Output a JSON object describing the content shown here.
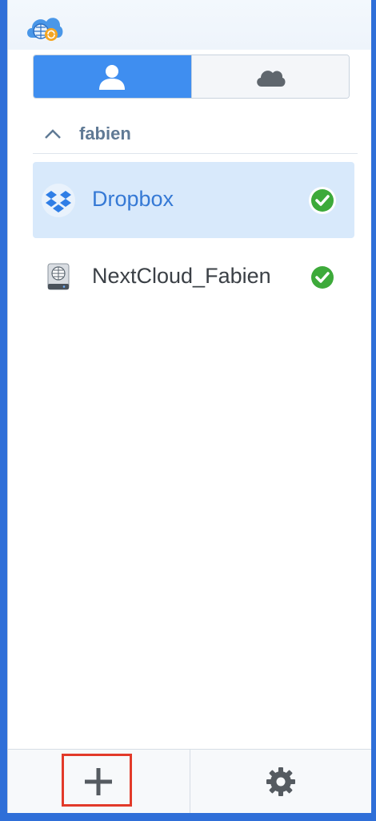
{
  "app": {
    "icon": "cloud-sync-app-icon"
  },
  "tabs": [
    {
      "name": "user-tab",
      "icon": "user-icon",
      "active": true
    },
    {
      "name": "cloud-tab",
      "icon": "cloud-icon",
      "active": false
    }
  ],
  "group": {
    "name": "fabien",
    "icon": "chevron-up-icon"
  },
  "connections": [
    {
      "label": "Dropbox",
      "icon": "dropbox-icon",
      "status": "synced",
      "selected": true
    },
    {
      "label": "NextCloud_Fabien",
      "icon": "webdav-server-icon",
      "status": "synced",
      "selected": false
    }
  ],
  "footer": {
    "add_icon": "plus-icon",
    "settings_icon": "gear-icon"
  },
  "colors": {
    "accent": "#3f8ef0",
    "selected_bg": "#d8e9fb",
    "status_ok": "#3daa3a",
    "highlight": "#e23a2a"
  }
}
